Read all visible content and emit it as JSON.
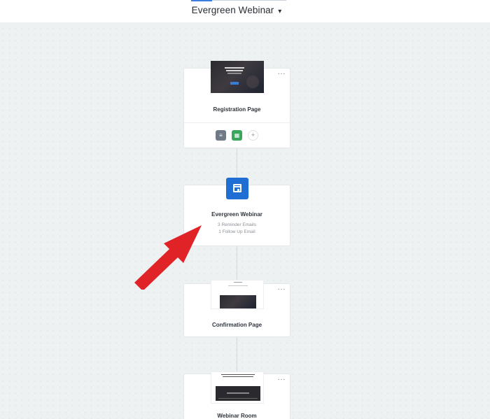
{
  "header": {
    "title": "Evergreen Webinar",
    "caret": "▾"
  },
  "cards": {
    "registration": {
      "label": "Registration Page",
      "more": "···",
      "actions": [
        {
          "icon": "list-icon",
          "glyph": "≡"
        },
        {
          "icon": "calendar-icon",
          "glyph": "▦"
        },
        {
          "icon": "plus-icon",
          "glyph": "+"
        }
      ]
    },
    "webinar": {
      "label": "Evergreen Webinar",
      "reminder": "3 Reminder Emails",
      "followup": "1 Follow Up Email"
    },
    "confirmation": {
      "label": "Confirmation Page",
      "more": "···"
    },
    "webinar_room": {
      "label": "Webinar Room",
      "more": "···"
    }
  },
  "colors": {
    "canvas": "#eef1f1",
    "accent_blue": "#1f6ed4",
    "arrow_red": "#e02327",
    "green": "#3aa55d",
    "gray": "#6f7a86"
  }
}
